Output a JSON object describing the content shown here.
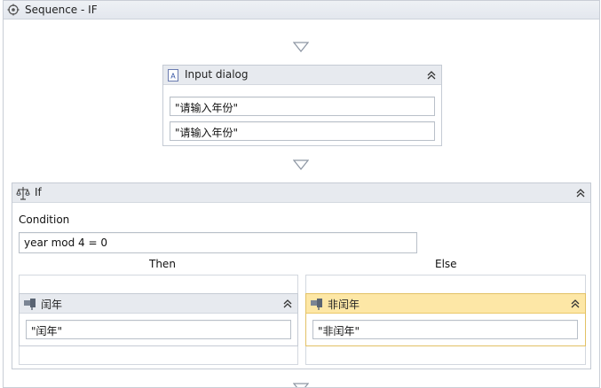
{
  "sequence": {
    "title": "Sequence - IF",
    "icon": "sequence-icon"
  },
  "input_dialog": {
    "title": "Input dialog",
    "icon": "input-dialog-icon",
    "field1": "\"请输入年份\"",
    "field2": "\"请输入年份\""
  },
  "if_activity": {
    "title": "If",
    "icon": "if-icon",
    "condition_label": "Condition",
    "condition_value": "year mod 4 = 0",
    "then_label": "Then",
    "else_label": "Else"
  },
  "then_activity": {
    "title": "闰年",
    "icon": "message-icon",
    "value": "\"闰年\""
  },
  "else_activity": {
    "title": "非闰年",
    "icon": "message-icon",
    "value": "\"非闰年\""
  },
  "colors": {
    "header_gray": "#e7eaef",
    "header_yellow": "#fde7a6",
    "border": "#c5cbd4",
    "arrow": "#8d96a3"
  }
}
